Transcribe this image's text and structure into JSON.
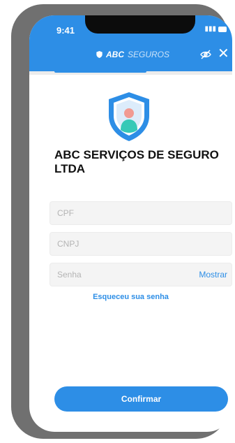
{
  "status_bar": {
    "time": "9:41"
  },
  "header": {
    "brand_bold": "ABC",
    "brand_light": "SEGUROS",
    "close_symbol": "✕"
  },
  "company_name": "ABC SERVIÇOS DE SEGURO LTDA",
  "form": {
    "cpf_placeholder": "CPF",
    "cnpj_placeholder": "CNPJ",
    "password_placeholder": "Senha",
    "show_password_label": "Mostrar",
    "forgot_password_label": "Esqueceu sua senha"
  },
  "confirm_label": "Confirmar",
  "icons": {
    "shield": "shield-icon",
    "eye_off": "eye-off-icon",
    "close": "close-icon",
    "user": "user-icon"
  },
  "colors": {
    "primary": "#2d8ee6",
    "frame": "#707070",
    "avatar_head": "#f19a92",
    "avatar_body": "#36c9b7"
  }
}
